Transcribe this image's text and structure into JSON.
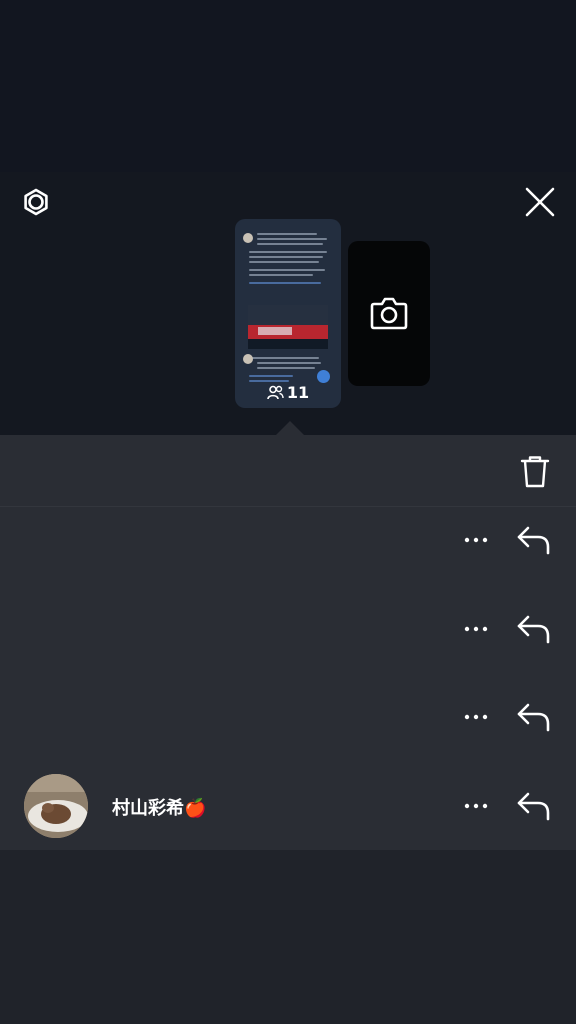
{
  "header": {
    "settings_icon": "settings-gear-icon",
    "close_icon": "close-icon"
  },
  "story": {
    "viewer_count": "11",
    "viewer_icon": "people-icon"
  },
  "camera": {
    "icon": "camera-icon"
  },
  "panel": {
    "delete_icon": "trash-icon"
  },
  "viewers": [
    {
      "name": "",
      "more_icon": "more-dots-icon",
      "reply_icon": "reply-icon"
    },
    {
      "name": "",
      "more_icon": "more-dots-icon",
      "reply_icon": "reply-icon"
    },
    {
      "name": "",
      "more_icon": "more-dots-icon",
      "reply_icon": "reply-icon"
    },
    {
      "name": "村山彩希🍎",
      "more_icon": "more-dots-icon",
      "reply_icon": "reply-icon"
    }
  ]
}
